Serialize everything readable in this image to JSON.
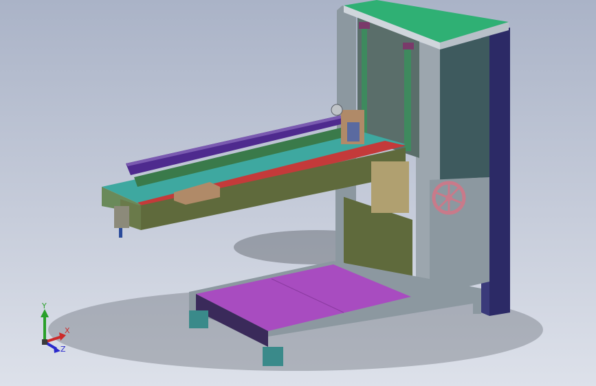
{
  "viewport": {
    "background_top": "#aab3c7",
    "background_bottom": "#dde1ea"
  },
  "triad": {
    "x_label": "X",
    "y_label": "Y",
    "z_label": "Z",
    "x_color": "#cc2a2a",
    "y_color": "#2aa02a",
    "z_color": "#2a2acc"
  },
  "model": {
    "colors": {
      "top_plate": "#2fb074",
      "frame": "#8c98a0",
      "column_panel": "#3e5a5e",
      "dark_post": "#2c2a66",
      "base_plate": "#a84cc0",
      "lower_panel": "#5f6a3c",
      "arm_red": "#c43a3a",
      "arm_teal": "#3ea8a0",
      "rail_purple": "#4e2a8e",
      "handwheel": "#c97a8a",
      "block": "#b08a68"
    }
  }
}
